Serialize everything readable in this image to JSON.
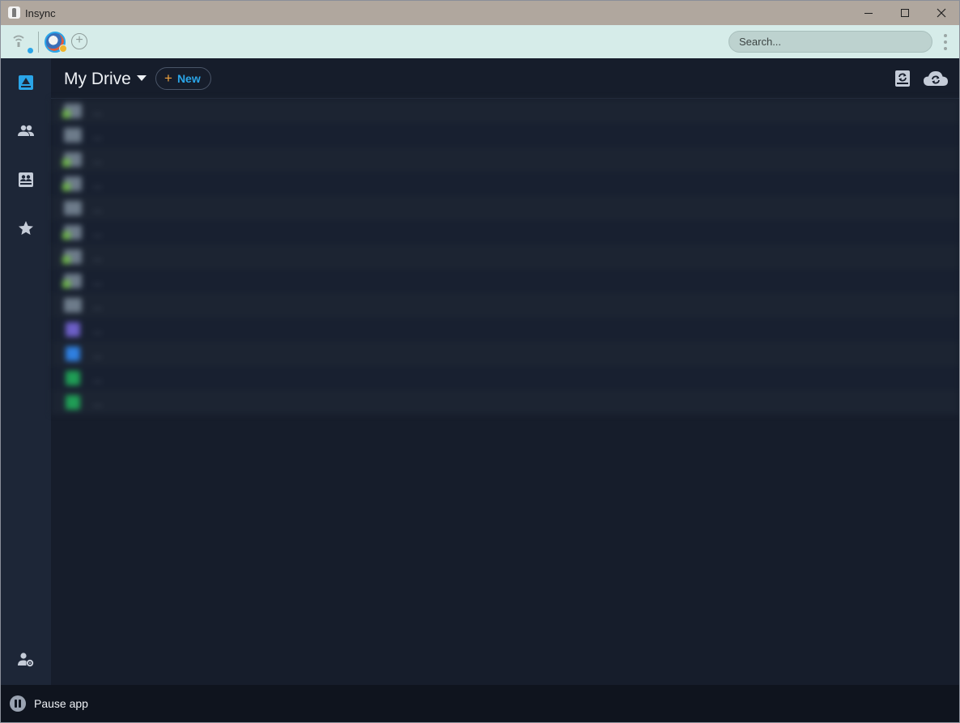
{
  "window": {
    "title": "Insync",
    "controls": [
      "minimize",
      "maximize",
      "close"
    ]
  },
  "account_bar": {
    "connection_icon": "wifi-signal-icon",
    "avatar_icon": "avatar",
    "add_account_icon": "plus-circle-icon",
    "add_account_symbol": "+",
    "search": {
      "placeholder": "Search...",
      "value": ""
    },
    "more_icon": "kebab-menu-icon"
  },
  "sidebar": {
    "items": [
      {
        "name": "my-drive",
        "icon": "drive-icon",
        "active": true
      },
      {
        "name": "shared-with-me",
        "icon": "people-icon",
        "active": false
      },
      {
        "name": "shared-drives",
        "icon": "shared-drive-icon",
        "active": false
      },
      {
        "name": "starred",
        "icon": "star-icon",
        "active": false
      }
    ],
    "bottom_item": {
      "name": "account-settings",
      "icon": "user-settings-icon"
    }
  },
  "main": {
    "title": "My Drive",
    "new_button": {
      "symbol": "+",
      "label": "New"
    },
    "header_icons": [
      "local-sync-icon",
      "cloud-sync-icon"
    ]
  },
  "files": [
    {
      "type": "folder",
      "shared": true,
      "name": "..."
    },
    {
      "type": "folder",
      "shared": false,
      "name": "..."
    },
    {
      "type": "folder",
      "shared": true,
      "name": "..."
    },
    {
      "type": "folder",
      "shared": true,
      "name": "..."
    },
    {
      "type": "folder",
      "shared": false,
      "name": "..."
    },
    {
      "type": "folder",
      "shared": true,
      "name": "..."
    },
    {
      "type": "folder",
      "shared": true,
      "name": "..."
    },
    {
      "type": "folder",
      "shared": true,
      "name": "..."
    },
    {
      "type": "folder",
      "shared": false,
      "name": "..."
    },
    {
      "type": "doc-purple",
      "shared": false,
      "name": "..."
    },
    {
      "type": "doc-blue",
      "shared": false,
      "name": "..."
    },
    {
      "type": "doc-green",
      "shared": false,
      "name": "..."
    },
    {
      "type": "doc-green",
      "shared": false,
      "name": "..."
    }
  ],
  "footer": {
    "pause_icon": "pause-icon",
    "pause_label": "Pause app"
  },
  "colors": {
    "accent": "#2aa5e8",
    "new_plus": "#f0a23c",
    "titlebar": "#b0a79e",
    "accountbar": "#d6ece9",
    "sidebar": "#1d2637",
    "main_bg": "#161d2b"
  }
}
